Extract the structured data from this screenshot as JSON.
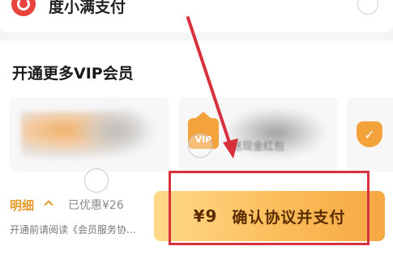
{
  "payment": {
    "option_label": "度小满支付",
    "icon": "duxiaoman-logo-icon",
    "radio_icon": "radio-unchecked-icon"
  },
  "vip_section": {
    "title": "开通更多VIP会员",
    "cards": [
      {
        "icon": "blurred-vip-logo",
        "label": ""
      },
      {
        "icon": "vip-crown-icon",
        "badge": "VIP",
        "label": "送现金红包"
      },
      {
        "icon": "vip-shield-icon",
        "badge": "✓",
        "label": ""
      }
    ]
  },
  "bottom_bar": {
    "detail_label": "明细",
    "detail_icon": "chevron-up-icon",
    "discount_text": "已优惠¥26",
    "agreement_text": "开通前请阅读《会员服务协...",
    "price": "¥9",
    "confirm_label": "确认协议并支付"
  },
  "annotation": {
    "color": "#d6313d",
    "arrow_icon": "red-arrow-icon"
  },
  "colors": {
    "accent": "#e59b2a",
    "button_start": "#ffd98a",
    "button_end": "#f6a843",
    "button_text": "#5a2c00",
    "pay_icon": "#e8433c"
  }
}
